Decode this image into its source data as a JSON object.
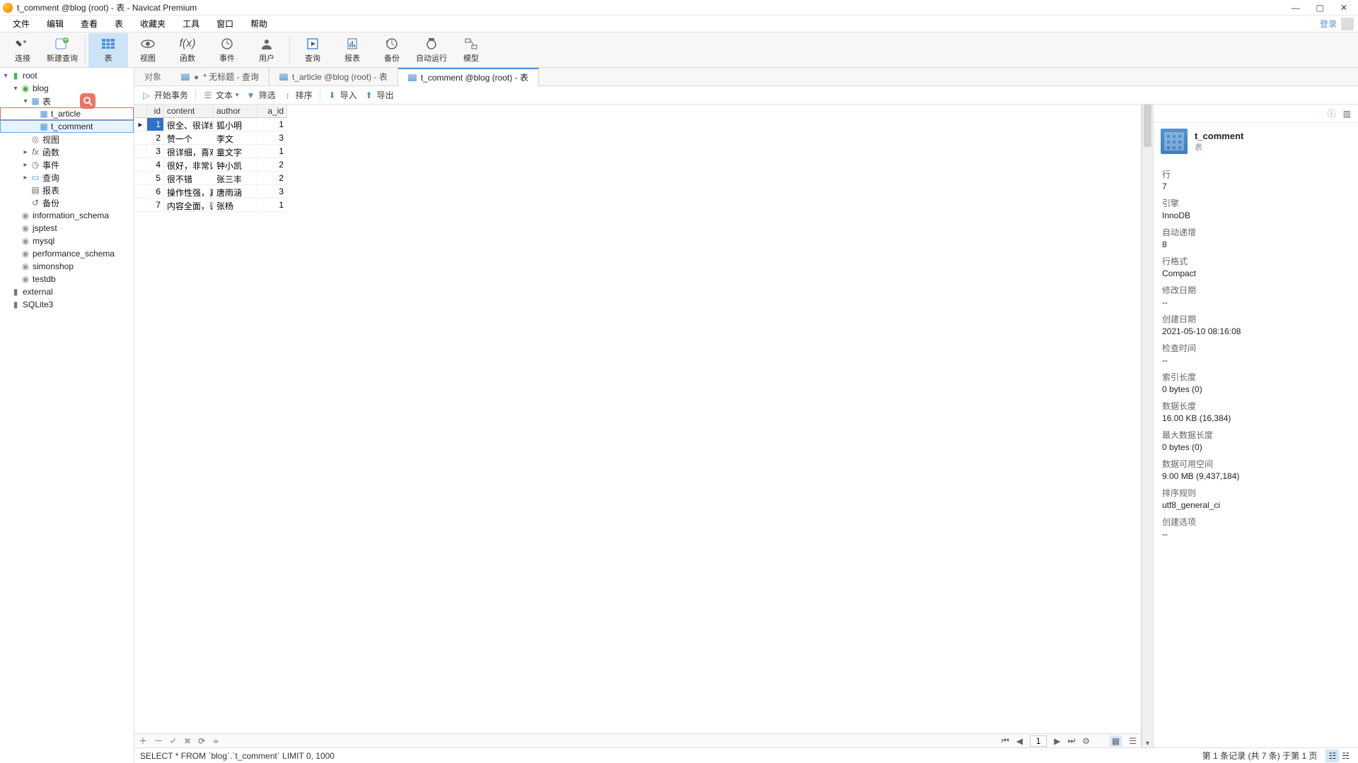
{
  "window": {
    "title": "t_comment @blog (root) - 表 - Navicat Premium"
  },
  "menu": {
    "items": [
      "文件",
      "编辑",
      "查看",
      "表",
      "收藏夹",
      "工具",
      "窗口",
      "帮助"
    ],
    "login": "登录"
  },
  "toolbar": {
    "items": [
      {
        "label": "连接",
        "name": "connect"
      },
      {
        "label": "新建查询",
        "name": "new-query"
      },
      {
        "label": "表",
        "name": "table",
        "active": true
      },
      {
        "label": "视图",
        "name": "view"
      },
      {
        "label": "函数",
        "name": "function"
      },
      {
        "label": "事件",
        "name": "event"
      },
      {
        "label": "用户",
        "name": "user"
      },
      {
        "label": "查询",
        "name": "query"
      },
      {
        "label": "报表",
        "name": "report"
      },
      {
        "label": "备份",
        "name": "backup"
      },
      {
        "label": "自动运行",
        "name": "automation"
      },
      {
        "label": "模型",
        "name": "model"
      }
    ]
  },
  "sidebar": {
    "root": "root",
    "blog": "blog",
    "tables_group": "表",
    "t_article": "t_article",
    "t_comment": "t_comment",
    "views": "视图",
    "functions": "函数",
    "events": "事件",
    "queries": "查询",
    "reports": "报表",
    "backups": "备份",
    "information_schema": "information_schema",
    "jsptest": "jsptest",
    "mysql": "mysql",
    "performance_schema": "performance_schema",
    "simonshop": "simonshop",
    "testdb": "testdb",
    "external": "external",
    "sqlite3": "SQLite3"
  },
  "tabs": {
    "objects": "对象",
    "untitled": "* 无标题 - 查询",
    "t_article": "t_article @blog (root) - 表",
    "t_comment": "t_comment @blog (root) - 表"
  },
  "subtoolbar": {
    "begin_txn": "开始事务",
    "text": "文本",
    "filter": "筛选",
    "sort": "排序",
    "import": "导入",
    "export": "导出"
  },
  "table": {
    "headers": [
      "id",
      "content",
      "author",
      "a_id"
    ],
    "rows": [
      {
        "id": 1,
        "content": "很全、很详细",
        "author": "狐小明",
        "a_id": 1,
        "active": true
      },
      {
        "id": 2,
        "content": "赞一个",
        "author": "李文",
        "a_id": 3
      },
      {
        "id": 3,
        "content": "很详细，喜欢",
        "author": "童文字",
        "a_id": 1
      },
      {
        "id": 4,
        "content": "很好，非常详",
        "author": "钟小凯",
        "a_id": 2
      },
      {
        "id": 5,
        "content": "很不错",
        "author": "张三丰",
        "a_id": 2
      },
      {
        "id": 6,
        "content": "操作性强，真",
        "author": "唐雨涵",
        "a_id": 3
      },
      {
        "id": 7,
        "content": "内容全面，讲",
        "author": "张杨",
        "a_id": 1
      }
    ]
  },
  "gridfoot": {
    "page": "1"
  },
  "status": {
    "sql": "SELECT * FROM `blog`.`t_comment` LIMIT 0, 1000",
    "record": "第 1 条记录 (共 7 条) 于第 1 页"
  },
  "inspector": {
    "name": "t_comment",
    "type": "表",
    "props": [
      {
        "k": "行",
        "v": "7"
      },
      {
        "k": "引擎",
        "v": "InnoDB"
      },
      {
        "k": "自动递增",
        "v": "8"
      },
      {
        "k": "行格式",
        "v": "Compact"
      },
      {
        "k": "修改日期",
        "v": "--"
      },
      {
        "k": "创建日期",
        "v": "2021-05-10 08:16:08"
      },
      {
        "k": "检查时间",
        "v": "--"
      },
      {
        "k": "索引长度",
        "v": "0 bytes (0)"
      },
      {
        "k": "数据长度",
        "v": "16.00 KB (16,384)"
      },
      {
        "k": "最大数据长度",
        "v": "0 bytes (0)"
      },
      {
        "k": "数据可用空间",
        "v": "9.00 MB (9,437,184)"
      },
      {
        "k": "排序规则",
        "v": "utf8_general_ci"
      },
      {
        "k": "创建选项",
        "v": "--"
      }
    ]
  }
}
